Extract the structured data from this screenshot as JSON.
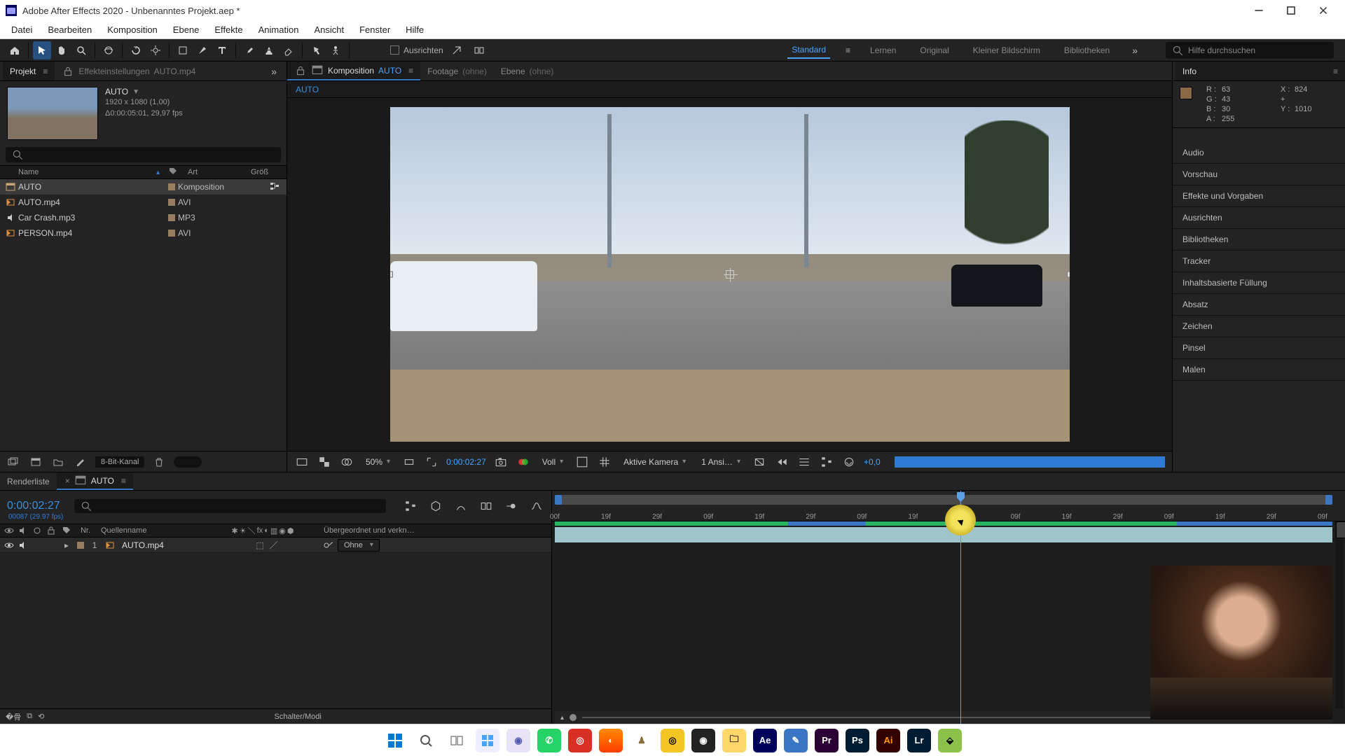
{
  "window": {
    "title": "Adobe After Effects 2020 - Unbenanntes Projekt.aep *"
  },
  "menu": {
    "items": [
      "Datei",
      "Bearbeiten",
      "Komposition",
      "Ebene",
      "Effekte",
      "Animation",
      "Ansicht",
      "Fenster",
      "Hilfe"
    ]
  },
  "toolbar": {
    "align_label": "Ausrichten",
    "search_placeholder": "Hilfe durchsuchen"
  },
  "workspaces": {
    "items": [
      "Standard",
      "Lernen",
      "Original",
      "Kleiner Bildschirm",
      "Bibliotheken"
    ],
    "active": "Standard"
  },
  "left_tabs": {
    "project": "Projekt",
    "ec_prefix": "Effekteinstellungen",
    "ec_target": "AUTO.mp4"
  },
  "project": {
    "name": "AUTO",
    "res_line": "1920 x 1080 (1,00)",
    "dur_line": "Δ0:00:05:01, 29,97 fps",
    "cols": {
      "name": "Name",
      "art": "Art",
      "groesse": "Größ"
    },
    "rows": [
      {
        "name": "AUTO",
        "art": "Komposition",
        "kind": "comp",
        "selected": true
      },
      {
        "name": "AUTO.mp4",
        "art": "AVI",
        "kind": "video"
      },
      {
        "name": "Car Crash.mp3",
        "art": "MP3",
        "kind": "audio"
      },
      {
        "name": "PERSON.mp4",
        "art": "AVI",
        "kind": "video"
      }
    ],
    "footer_bit": "8-Bit-Kanal"
  },
  "center_tabs": {
    "comp_prefix": "Komposition",
    "comp_name": "AUTO",
    "footage_prefix": "Footage",
    "footage_name": "(ohne)",
    "layer_prefix": "Ebene",
    "layer_name": "(ohne)",
    "sub_comp": "AUTO"
  },
  "viewer_controls": {
    "zoom": "50%",
    "time": "0:00:02:27",
    "res": "Voll",
    "camera": "Aktive Kamera",
    "views": "1 Ansi…",
    "exposure": "+0,0"
  },
  "info_panel": {
    "title": "Info",
    "r": "63",
    "g": "43",
    "b": "30",
    "a": "255",
    "x": "824",
    "y": "1010",
    "labels": {
      "R": "R :",
      "G": "G :",
      "B": "B :",
      "A": "A :",
      "X": "X :",
      "Y": "Y :",
      "plus": "+"
    }
  },
  "right_accordions": [
    "Audio",
    "Vorschau",
    "Effekte und Vorgaben",
    "Ausrichten",
    "Bibliotheken",
    "Tracker",
    "Inhaltsbasierte Füllung",
    "Absatz",
    "Zeichen",
    "Pinsel",
    "Malen"
  ],
  "timeline": {
    "tab_render": "Renderliste",
    "tab_comp": "AUTO",
    "timecode": "0:00:02:27",
    "sub_tc": "00087 (29.97 fps)",
    "headers": {
      "nr": "Nr.",
      "src": "Quellenname",
      "parent": "Übergeordnet und verkn…"
    },
    "layer1": {
      "num": "1",
      "name": "AUTO.mp4",
      "parent": "Ohne"
    },
    "ruler": [
      "00f",
      "19f",
      "29f",
      "09f",
      "19f",
      "29f",
      "09f",
      "19f",
      "29f",
      "09f",
      "19f",
      "29f",
      "09f",
      "19f",
      "29f",
      "09f"
    ],
    "footer": "Schalter/Modi"
  },
  "colors": {
    "accent": "#3a76c4",
    "link": "#4aa3ff"
  }
}
